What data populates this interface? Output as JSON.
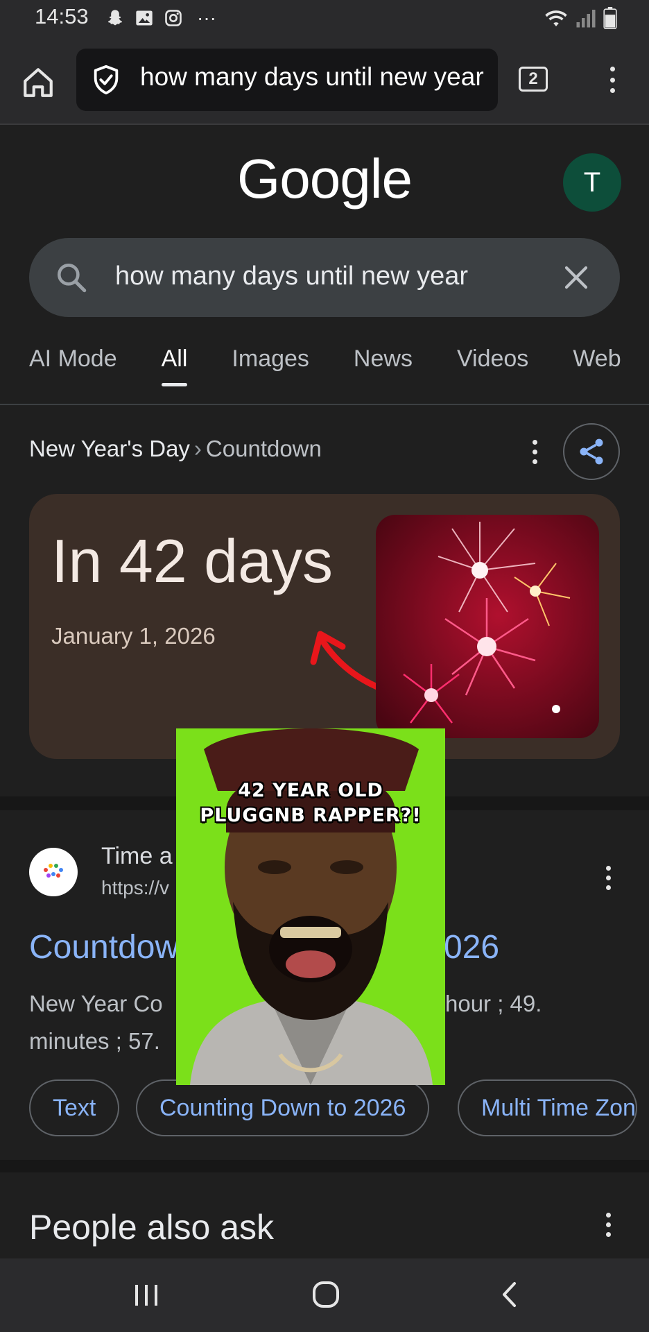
{
  "status_bar": {
    "time": "14:53",
    "overflow": "···",
    "icons": [
      "snapchat-icon",
      "gallery-icon",
      "instagram-icon",
      "wifi-icon",
      "signal-icon",
      "battery-icon"
    ]
  },
  "browser": {
    "url_text": "how many days until new year",
    "tab_count": "2",
    "icons": [
      "home-icon",
      "shield-icon",
      "menu-icon"
    ]
  },
  "google": {
    "logo": "Google",
    "avatar_letter": "T",
    "avatar_color": "#0d4e3a",
    "search_query": "how many days until new year"
  },
  "nav_tabs": [
    {
      "label": "AI Mode",
      "active": false
    },
    {
      "label": "All",
      "active": true
    },
    {
      "label": "Images",
      "active": false
    },
    {
      "label": "News",
      "active": false
    },
    {
      "label": "Videos",
      "active": false
    },
    {
      "label": "Web",
      "active": false
    }
  ],
  "answer": {
    "breadcrumb_main": "New Year's Day",
    "breadcrumb_sep": "›",
    "breadcrumb_sub": "Countdown",
    "headline": "In 42 days",
    "date": "January 1, 2026",
    "card_color": "#3b2e27"
  },
  "result": {
    "site_name": "Time a",
    "site_url": "https://v",
    "title_left": "Countdow",
    "title_right": "026",
    "snippet_line1_left": "New Year Co",
    "snippet_line1_right": "hour ; 49.",
    "snippet_line2": "minutes ; 57.",
    "chips": [
      "Text",
      "Counting Down to 2026",
      "Multi Time Zon"
    ]
  },
  "people_also_ask": "People also ask",
  "overlay": {
    "caption_line1": "42 YEAR OLD",
    "caption_line2": "PLUGGNB RAPPER?!",
    "background": "#7be01a"
  },
  "system_nav": {
    "icons": [
      "recent-apps-icon",
      "home-circle-icon",
      "back-icon"
    ]
  },
  "colors": {
    "link": "#8ab4f8",
    "background": "#1f1f1f"
  }
}
